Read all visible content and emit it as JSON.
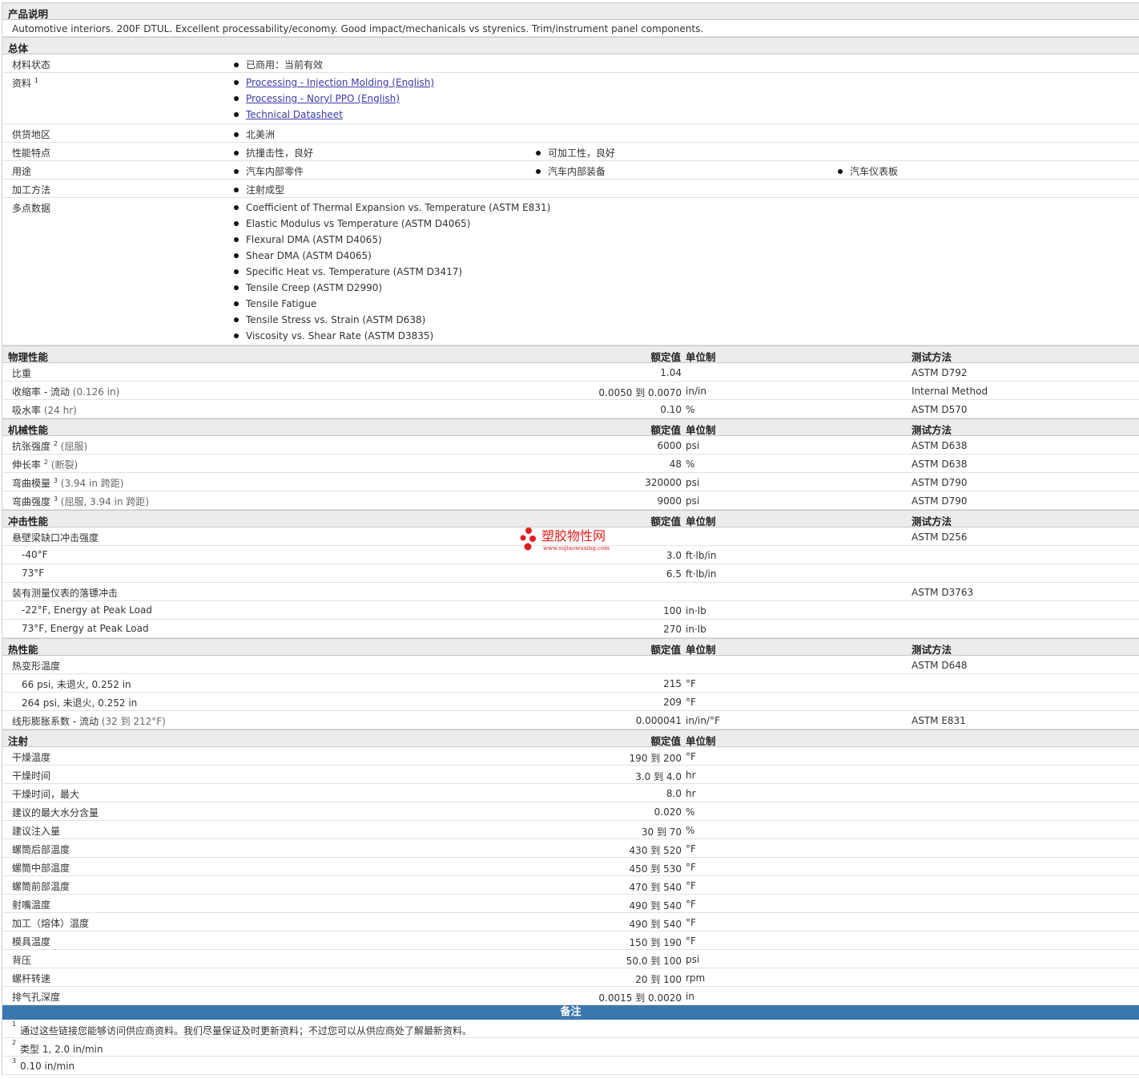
{
  "product_desc": {
    "title": "产品说明",
    "text": "Automotive interiors. 200F DTUL. Excellent processability/economy. Good impact/mechanicals vs styrenics. Trim/instrument panel components."
  },
  "general": {
    "title": "总体",
    "status_label": "材料状态",
    "status_value": "已商用：当前有效",
    "docs_label": "资料",
    "docs_sup": "1",
    "docs": [
      "Processing - Injection Molding (English)",
      "Processing - Noryl PPO (English)",
      "Technical Datasheet"
    ],
    "region_label": "供货地区",
    "region_value": "北美洲",
    "features_label": "性能特点",
    "features": [
      "抗撞击性，良好",
      "可加工性，良好"
    ],
    "uses_label": "用途",
    "uses": [
      "汽车内部零件",
      "汽车内部装备",
      "汽车仪表板"
    ],
    "process_label": "加工方法",
    "process_value": "注射成型",
    "multipoint_label": "多点数据",
    "multipoint": [
      "Coefficient of Thermal Expansion vs. Temperature (ASTM E831)",
      "Elastic Modulus vs Temperature (ASTM D4065)",
      "Flexural DMA (ASTM D4065)",
      "Shear DMA (ASTM D4065)",
      "Specific Heat vs. Temperature (ASTM D3417)",
      "Tensile Creep (ASTM D2990)",
      "Tensile Fatigue",
      "Tensile Stress vs. Strain (ASTM D638)",
      "Viscosity vs. Shear Rate (ASTM D3835)"
    ]
  },
  "headers": {
    "value": "额定值",
    "unit": "单位制",
    "method": "测试方法"
  },
  "physical": {
    "title": "物理性能",
    "rows": [
      {
        "label": "比重",
        "sub": "",
        "value": "1.04",
        "unit": "",
        "method": "ASTM D792"
      },
      {
        "label": "收缩率 - 流动",
        "sub": "(0.126 in)",
        "value": "0.0050 到  0.0070",
        "unit": "in/in",
        "method": "Internal Method"
      },
      {
        "label": "吸水率",
        "sub": "(24 hr)",
        "value": "0.10",
        "unit": "%",
        "method": "ASTM D570"
      }
    ]
  },
  "mechanical": {
    "title": "机械性能",
    "rows": [
      {
        "label": "抗张强度",
        "sup": "2",
        "sub": "(屈服)",
        "value": "6000",
        "unit": "psi",
        "method": "ASTM D638"
      },
      {
        "label": "伸长率",
        "sup": "2",
        "sub": "(断裂)",
        "value": "48",
        "unit": "%",
        "method": "ASTM D638"
      },
      {
        "label": "弯曲模量",
        "sup": "3",
        "sub": "(3.94 in 跨距)",
        "value": "320000",
        "unit": "psi",
        "method": "ASTM D790"
      },
      {
        "label": "弯曲强度",
        "sup": "3",
        "sub": "(屈服, 3.94 in 跨距)",
        "value": "9000",
        "unit": "psi",
        "method": "ASTM D790"
      }
    ]
  },
  "impact": {
    "title": "冲击性能",
    "izod_label": "悬壁梁缺口冲击强度",
    "izod_method": "ASTM D256",
    "izod_rows": [
      {
        "label": "-40°F",
        "value": "3.0",
        "unit": "ft·lb/in"
      },
      {
        "label": "73°F",
        "value": "6.5",
        "unit": "ft·lb/in"
      }
    ],
    "dart_label": "装有测量仪表的落镖冲击",
    "dart_method": "ASTM D3763",
    "dart_rows": [
      {
        "label": "-22°F, Energy at Peak Load",
        "value": "100",
        "unit": "in·lb"
      },
      {
        "label": "73°F, Energy at Peak Load",
        "value": "270",
        "unit": "in·lb"
      }
    ]
  },
  "thermal": {
    "title": "热性能",
    "hdt_label": "热变形温度",
    "hdt_method": "ASTM D648",
    "hdt_rows": [
      {
        "label": "66 psi, 未退火, 0.252 in",
        "value": "215",
        "unit": "°F"
      },
      {
        "label": "264 psi, 未退火, 0.252 in",
        "value": "209",
        "unit": "°F"
      }
    ],
    "clte_label": "线形膨胀系数 - 流动",
    "clte_sub": "(32 到  212°F)",
    "clte_value": "0.000041",
    "clte_unit": "in/in/°F",
    "clte_method": "ASTM E831"
  },
  "injection": {
    "title": "注射",
    "rows": [
      {
        "label": "干燥温度",
        "value": "190 到  200",
        "unit": "°F"
      },
      {
        "label": "干燥时间",
        "value": "3.0 到  4.0",
        "unit": "hr"
      },
      {
        "label": "干燥时间，最大",
        "value": "8.0",
        "unit": "hr"
      },
      {
        "label": "建议的最大水分含量",
        "value": "0.020",
        "unit": "%"
      },
      {
        "label": "建议注入量",
        "value": "30 到  70",
        "unit": "%"
      },
      {
        "label": "螺筒后部温度",
        "value": "430 到  520",
        "unit": "°F"
      },
      {
        "label": "螺筒中部温度",
        "value": "450 到  530",
        "unit": "°F"
      },
      {
        "label": "螺筒前部温度",
        "value": "470 到  540",
        "unit": "°F"
      },
      {
        "label": "射嘴温度",
        "value": "490 到  540",
        "unit": "°F"
      },
      {
        "label": "加工（熔体）温度",
        "value": "490 到  540",
        "unit": "°F"
      },
      {
        "label": "模具温度",
        "value": "150 到  190",
        "unit": "°F"
      },
      {
        "label": "背压",
        "value": "50.0 到  100",
        "unit": "psi"
      },
      {
        "label": "螺杆转速",
        "value": "20 到  100",
        "unit": "rpm"
      },
      {
        "label": "排气孔深度",
        "value": "0.0015 到  0.0020",
        "unit": "in"
      }
    ]
  },
  "notes": {
    "title": "备注",
    "items": [
      {
        "n": "1",
        "text": "通过这些链接您能够访问供应商资料。我们尽量保证及时更新资料；不过您可以从供应商处了解最新资料。"
      },
      {
        "n": "2",
        "text": "类型  1, 2.0 in/min"
      },
      {
        "n": "3",
        "text": "0.10 in/min"
      }
    ]
  },
  "watermark": {
    "name": "塑胶物性网",
    "url": "www.sujiaowuxing.com",
    "color": "#e02020"
  }
}
